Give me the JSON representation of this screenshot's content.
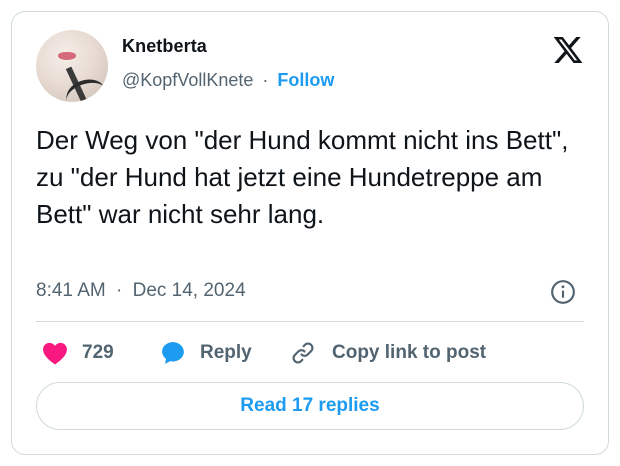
{
  "author": {
    "name": "Knetberta",
    "handle": "@KopfVollKnete",
    "separator": "·",
    "follow_label": "Follow"
  },
  "tweet": {
    "text": "Der Weg von \"der Hund kommt nicht ins Bett\", zu \"der Hund hat jetzt eine Hundetreppe am Bett\" war nicht sehr lang.",
    "time": "8:41 AM",
    "separator": "·",
    "date": "Dec 14, 2024"
  },
  "actions": {
    "like_count": "729",
    "reply_label": "Reply",
    "copy_label": "Copy link to post"
  },
  "replies_button": "Read 17 replies",
  "colors": {
    "accent": "#1d9bf0",
    "like": "#f91880",
    "muted": "#536471",
    "text": "#0f1419",
    "border": "#cfd9de"
  },
  "icons": [
    "x-logo-icon",
    "info-icon",
    "heart-icon",
    "speech-bubble-icon",
    "link-icon"
  ]
}
